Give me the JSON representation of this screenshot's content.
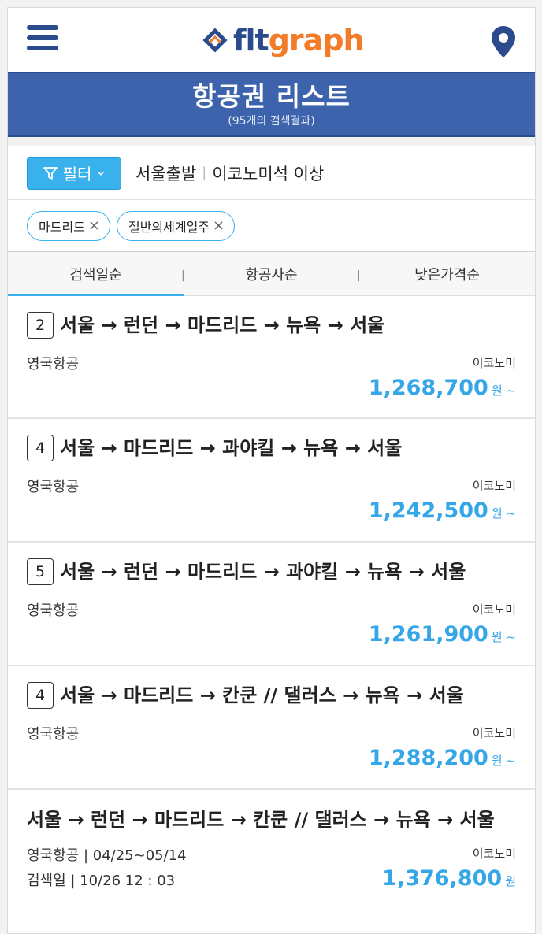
{
  "topbar": {
    "logo_flt": "flt",
    "logo_graph": "graph"
  },
  "header": {
    "title": "항공권 리스트",
    "subtitle": "(95개의 검색결과)"
  },
  "filter": {
    "button_label": "필터",
    "summary_left": "서울출발",
    "summary_sep": "|",
    "summary_right": "이코노미석 이상"
  },
  "chips": [
    {
      "label": "마드리드"
    },
    {
      "label": "절반의세계일주"
    }
  ],
  "tabs": [
    {
      "label": "검색일순",
      "active": true
    },
    {
      "label": "항공사순",
      "active": false
    },
    {
      "label": "낮은가격순",
      "active": false
    }
  ],
  "tab_separator": "|",
  "results": [
    {
      "badge": "2",
      "route": "서울 → 런던 → 마드리드 → 뉴욕 → 서울",
      "airline": "영국항공",
      "cabin": "이코노미",
      "price": "1,268,700",
      "unit": "원 ~"
    },
    {
      "badge": "4",
      "route": "서울 → 마드리드 → 과야킬 → 뉴욕 → 서울",
      "airline": "영국항공",
      "cabin": "이코노미",
      "price": "1,242,500",
      "unit": "원 ~"
    },
    {
      "badge": "5",
      "route": "서울 → 런던 → 마드리드 → 과야킬 → 뉴욕 → 서울",
      "airline": "영국항공",
      "cabin": "이코노미",
      "price": "1,261,900",
      "unit": "원 ~"
    },
    {
      "badge": "4",
      "route": "서울 → 마드리드 → 칸쿤 // 댈러스 → 뉴욕 → 서울",
      "airline": "영국항공",
      "cabin": "이코노미",
      "price": "1,288,200",
      "unit": "원 ~"
    },
    {
      "route": "서울 → 런던 → 마드리드 → 칸쿤 // 댈러스 → 뉴욕 → 서울",
      "airline_line1": "영국항공 | 04/25~05/14",
      "airline_line2": "검색일 | 10/26  12 : 03",
      "cabin": "이코노미",
      "price": "1,376,800",
      "unit": "원"
    }
  ]
}
